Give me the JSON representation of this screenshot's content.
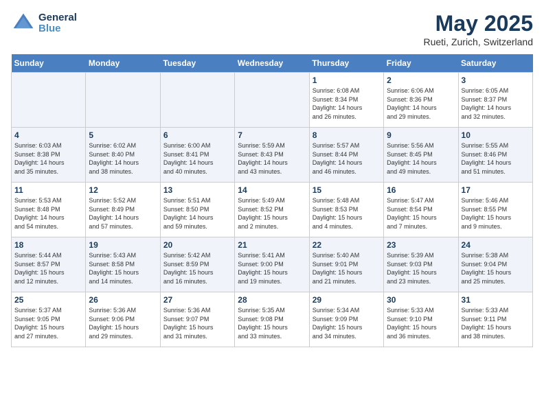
{
  "logo": {
    "line1": "General",
    "line2": "Blue"
  },
  "title": "May 2025",
  "location": "Rueti, Zurich, Switzerland",
  "days_of_week": [
    "Sunday",
    "Monday",
    "Tuesday",
    "Wednesday",
    "Thursday",
    "Friday",
    "Saturday"
  ],
  "weeks": [
    [
      {
        "day": "",
        "info": ""
      },
      {
        "day": "",
        "info": ""
      },
      {
        "day": "",
        "info": ""
      },
      {
        "day": "",
        "info": ""
      },
      {
        "day": "1",
        "info": "Sunrise: 6:08 AM\nSunset: 8:34 PM\nDaylight: 14 hours\nand 26 minutes."
      },
      {
        "day": "2",
        "info": "Sunrise: 6:06 AM\nSunset: 8:36 PM\nDaylight: 14 hours\nand 29 minutes."
      },
      {
        "day": "3",
        "info": "Sunrise: 6:05 AM\nSunset: 8:37 PM\nDaylight: 14 hours\nand 32 minutes."
      }
    ],
    [
      {
        "day": "4",
        "info": "Sunrise: 6:03 AM\nSunset: 8:38 PM\nDaylight: 14 hours\nand 35 minutes."
      },
      {
        "day": "5",
        "info": "Sunrise: 6:02 AM\nSunset: 8:40 PM\nDaylight: 14 hours\nand 38 minutes."
      },
      {
        "day": "6",
        "info": "Sunrise: 6:00 AM\nSunset: 8:41 PM\nDaylight: 14 hours\nand 40 minutes."
      },
      {
        "day": "7",
        "info": "Sunrise: 5:59 AM\nSunset: 8:43 PM\nDaylight: 14 hours\nand 43 minutes."
      },
      {
        "day": "8",
        "info": "Sunrise: 5:57 AM\nSunset: 8:44 PM\nDaylight: 14 hours\nand 46 minutes."
      },
      {
        "day": "9",
        "info": "Sunrise: 5:56 AM\nSunset: 8:45 PM\nDaylight: 14 hours\nand 49 minutes."
      },
      {
        "day": "10",
        "info": "Sunrise: 5:55 AM\nSunset: 8:46 PM\nDaylight: 14 hours\nand 51 minutes."
      }
    ],
    [
      {
        "day": "11",
        "info": "Sunrise: 5:53 AM\nSunset: 8:48 PM\nDaylight: 14 hours\nand 54 minutes."
      },
      {
        "day": "12",
        "info": "Sunrise: 5:52 AM\nSunset: 8:49 PM\nDaylight: 14 hours\nand 57 minutes."
      },
      {
        "day": "13",
        "info": "Sunrise: 5:51 AM\nSunset: 8:50 PM\nDaylight: 14 hours\nand 59 minutes."
      },
      {
        "day": "14",
        "info": "Sunrise: 5:49 AM\nSunset: 8:52 PM\nDaylight: 15 hours\nand 2 minutes."
      },
      {
        "day": "15",
        "info": "Sunrise: 5:48 AM\nSunset: 8:53 PM\nDaylight: 15 hours\nand 4 minutes."
      },
      {
        "day": "16",
        "info": "Sunrise: 5:47 AM\nSunset: 8:54 PM\nDaylight: 15 hours\nand 7 minutes."
      },
      {
        "day": "17",
        "info": "Sunrise: 5:46 AM\nSunset: 8:55 PM\nDaylight: 15 hours\nand 9 minutes."
      }
    ],
    [
      {
        "day": "18",
        "info": "Sunrise: 5:44 AM\nSunset: 8:57 PM\nDaylight: 15 hours\nand 12 minutes."
      },
      {
        "day": "19",
        "info": "Sunrise: 5:43 AM\nSunset: 8:58 PM\nDaylight: 15 hours\nand 14 minutes."
      },
      {
        "day": "20",
        "info": "Sunrise: 5:42 AM\nSunset: 8:59 PM\nDaylight: 15 hours\nand 16 minutes."
      },
      {
        "day": "21",
        "info": "Sunrise: 5:41 AM\nSunset: 9:00 PM\nDaylight: 15 hours\nand 19 minutes."
      },
      {
        "day": "22",
        "info": "Sunrise: 5:40 AM\nSunset: 9:01 PM\nDaylight: 15 hours\nand 21 minutes."
      },
      {
        "day": "23",
        "info": "Sunrise: 5:39 AM\nSunset: 9:03 PM\nDaylight: 15 hours\nand 23 minutes."
      },
      {
        "day": "24",
        "info": "Sunrise: 5:38 AM\nSunset: 9:04 PM\nDaylight: 15 hours\nand 25 minutes."
      }
    ],
    [
      {
        "day": "25",
        "info": "Sunrise: 5:37 AM\nSunset: 9:05 PM\nDaylight: 15 hours\nand 27 minutes."
      },
      {
        "day": "26",
        "info": "Sunrise: 5:36 AM\nSunset: 9:06 PM\nDaylight: 15 hours\nand 29 minutes."
      },
      {
        "day": "27",
        "info": "Sunrise: 5:36 AM\nSunset: 9:07 PM\nDaylight: 15 hours\nand 31 minutes."
      },
      {
        "day": "28",
        "info": "Sunrise: 5:35 AM\nSunset: 9:08 PM\nDaylight: 15 hours\nand 33 minutes."
      },
      {
        "day": "29",
        "info": "Sunrise: 5:34 AM\nSunset: 9:09 PM\nDaylight: 15 hours\nand 34 minutes."
      },
      {
        "day": "30",
        "info": "Sunrise: 5:33 AM\nSunset: 9:10 PM\nDaylight: 15 hours\nand 36 minutes."
      },
      {
        "day": "31",
        "info": "Sunrise: 5:33 AM\nSunset: 9:11 PM\nDaylight: 15 hours\nand 38 minutes."
      }
    ]
  ]
}
